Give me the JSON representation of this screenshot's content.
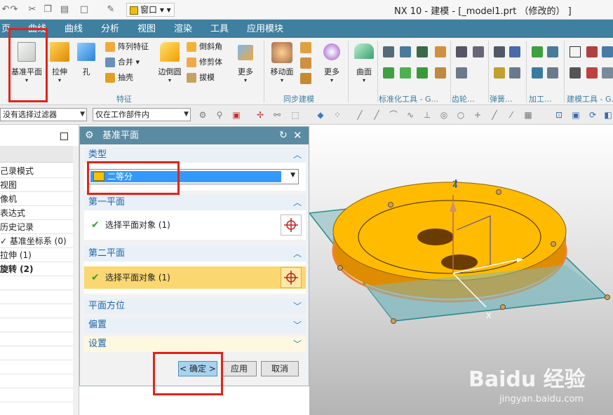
{
  "window": {
    "title": "NX 10 - 建模 - [_model1.prt （修改的） ]",
    "window_menu": "窗口"
  },
  "menu": {
    "tabs": [
      "曲线",
      "分析",
      "视图",
      "渲染",
      "工具",
      "应用模块"
    ]
  },
  "ribbon": {
    "datum_plane": "基准平面",
    "extrude": "拉伸",
    "hole": "孔",
    "pattern_feature": "阵列特征",
    "unite": "合并",
    "shell": "抽壳",
    "edge_blend": "边倒圆",
    "chamfer": "倒斜角",
    "trim_body": "修剪体",
    "draft": "拔模",
    "more_feature": "更多",
    "move_face": "移动面",
    "more_sync": "更多",
    "surface": "曲面",
    "groups": {
      "feature": "特征",
      "sync": "同步建模",
      "std_parts": "标准化工具 - G...",
      "gear": "齿轮...",
      "spring": "弹簧...",
      "machining": "加工...",
      "modeling_tools": "建模工具 - G..."
    }
  },
  "filterbar": {
    "filter": "没有选择过滤器",
    "scope": "仅在工作部件内"
  },
  "navigator": {
    "items": [
      {
        "label": "己录模式",
        "bold": false
      },
      {
        "label": "视图",
        "bold": false
      },
      {
        "label": "像机",
        "bold": false
      },
      {
        "label": "表达式",
        "bold": false
      },
      {
        "label": "历史记录",
        "bold": false
      },
      {
        "label": "✓ 基准坐标系 (0)",
        "bold": false
      },
      {
        "label": "拉伸 (1)",
        "bold": false
      },
      {
        "label": "旋转 (2)",
        "bold": true
      }
    ]
  },
  "dialog": {
    "title": "基准平面",
    "sections": {
      "type": "类型",
      "first_plane": "第一平面",
      "second_plane": "第二平面",
      "orientation": "平面方位",
      "offset": "偏置",
      "settings": "设置"
    },
    "type_value": "二等分",
    "first_select": "选择平面对象 (1)",
    "second_select": "选择平面对象 (1)",
    "buttons": {
      "ok": "< 确定 >",
      "apply": "应用",
      "cancel": "取消"
    }
  },
  "viewport": {
    "axis_z": "Z",
    "axis_x": "X"
  },
  "watermark": {
    "logo": "Baidu 经验",
    "url": "jingyan.baidu.com"
  },
  "colors": {
    "accent": "#3f7f9f",
    "dialog_title": "#5b8aa3",
    "active_row": "#fbd772",
    "selection": "#3399ff",
    "highlight_red": "#e2231a",
    "part_orange": "#ffbb00",
    "plane_teal": "#7fb8bd"
  }
}
